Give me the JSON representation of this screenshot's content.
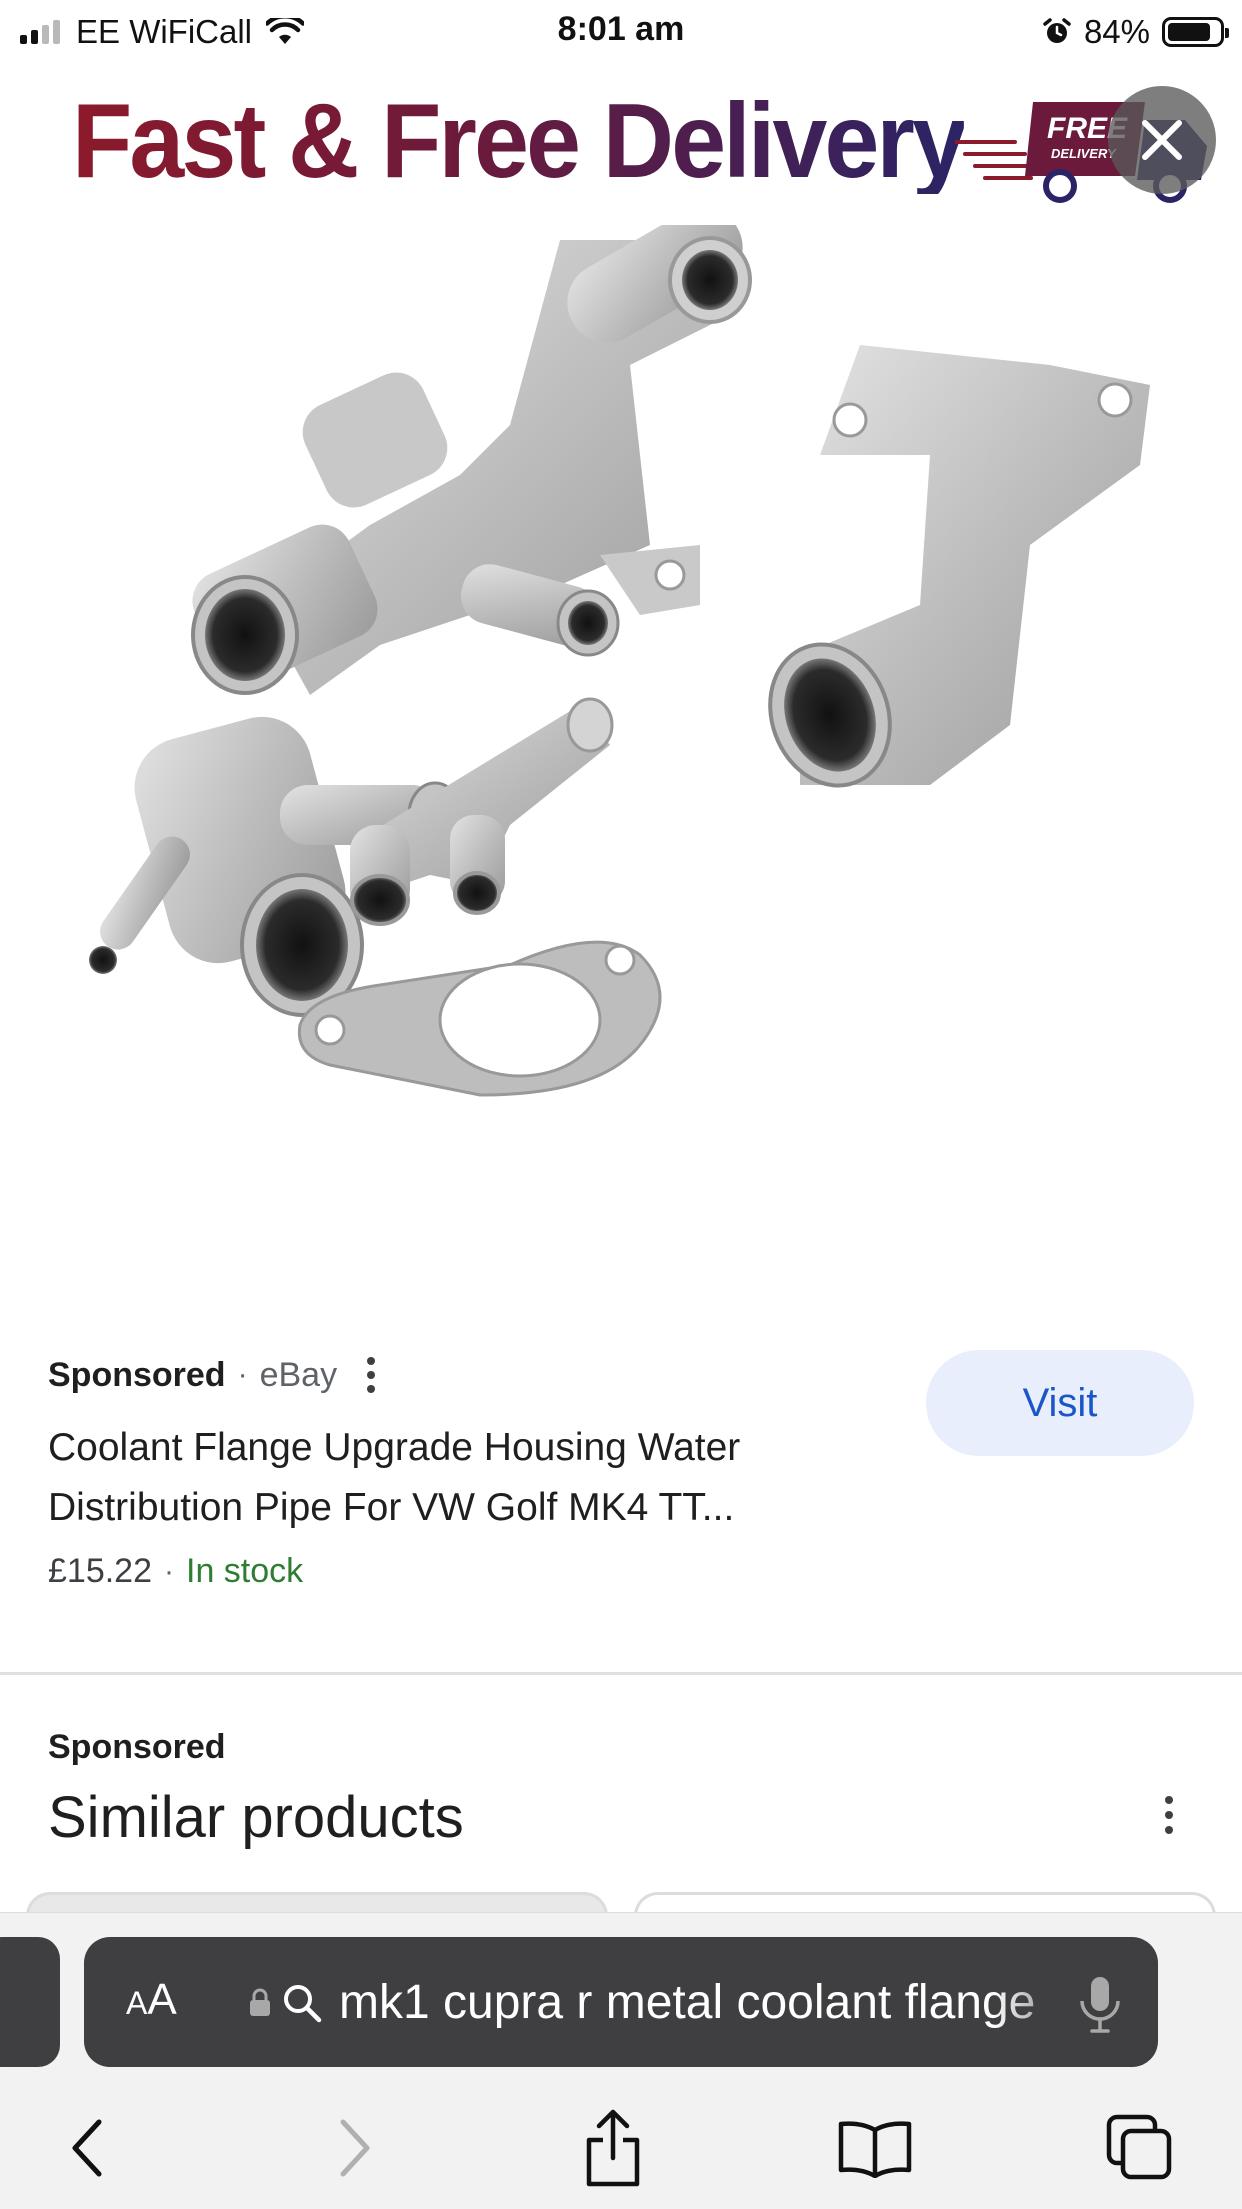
{
  "status_bar": {
    "carrier": "EE WiFiCall",
    "time": "8:01 am",
    "battery_percent": "84%",
    "battery_level": 0.84
  },
  "banner": {
    "text": "Fast & Free Delivery",
    "truck_text_1": "FREE",
    "truck_text_2": "DELIVERY",
    "close_icon": "close-icon"
  },
  "product": {
    "image_icon": "coolant-flange-parts-image",
    "sponsored": "Sponsored",
    "separator": "·",
    "merchant": "eBay",
    "visit_label": "Visit",
    "title": "Coolant Flange Upgrade Housing Water Distribution Pipe For VW Golf MK4 TT...",
    "price": "£15.22",
    "stock": "In stock"
  },
  "similar": {
    "sponsored": "Sponsored",
    "title": "Similar products"
  },
  "browser": {
    "aa_small": "A",
    "aa_big": "A",
    "url": "mk1 cupra r metal coolant flange"
  },
  "colors": {
    "visit_bg": "#e8eefb",
    "visit_text": "#1a56c8",
    "stock_green": "#2e7d32",
    "address_bar_bg": "#3f3f41"
  }
}
